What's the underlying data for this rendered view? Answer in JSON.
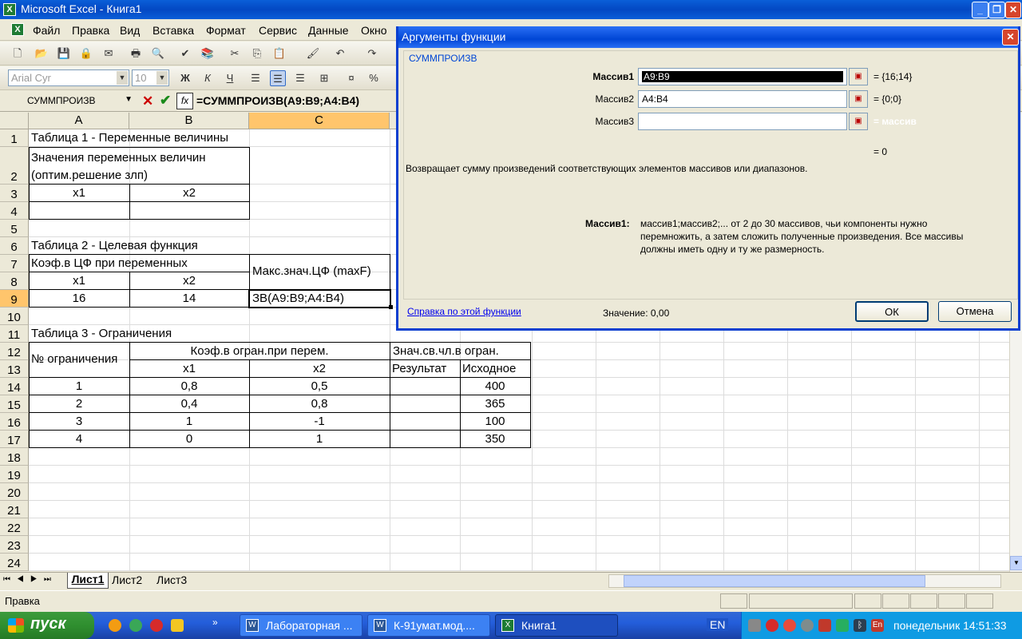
{
  "window": {
    "title": "Microsoft Excel - Книга1"
  },
  "menu": [
    "Файл",
    "Правка",
    "Вид",
    "Вставка",
    "Формат",
    "Сервис",
    "Данные",
    "Окно"
  ],
  "font": {
    "name": "Arial Cyr",
    "size": "10"
  },
  "namebox": "СУММПРОИЗВ",
  "formula": "=СУММПРОИЗВ(A9:B9;A4:B4)",
  "columns": [
    "A",
    "B",
    "C"
  ],
  "rows": [
    "1",
    "2",
    "3",
    "4",
    "5",
    "6",
    "7",
    "8",
    "9",
    "10",
    "11",
    "12",
    "13",
    "14",
    "15",
    "16",
    "17",
    "18",
    "19",
    "20",
    "21",
    "22",
    "23",
    "24"
  ],
  "cells": {
    "a1": "Таблица 1 - Переменные величины",
    "a2_1": "Значения переменных величин",
    "a2_2": "(оптим.решение злп)",
    "a3": "x1",
    "b3": "x2",
    "a6": "Таблица 2 - Целевая функция",
    "a7": "Коэф.в ЦФ при переменных",
    "c7": "Макс.знач.ЦФ (maxF)",
    "a8": "x1",
    "b8": "x2",
    "a9": "16",
    "b9": "14",
    "c9": "ЗВ(A9:B9;A4:B4)",
    "a11": "Таблица 3 - Ограничения",
    "a12": "№ ограничения",
    "b12": "Коэф.в огран.при перем.",
    "d12": "Знач.св.чл.в огран.",
    "b13": "x1",
    "c13": "x2",
    "d13": "Результат",
    "e13": "Исходное"
  },
  "table3": [
    {
      "n": "1",
      "x1": "0,8",
      "x2": "0,5",
      "src": "400"
    },
    {
      "n": "2",
      "x1": "0,4",
      "x2": "0,8",
      "src": "365"
    },
    {
      "n": "3",
      "x1": "1",
      "x2": "-1",
      "src": "100"
    },
    {
      "n": "4",
      "x1": "0",
      "x2": "1",
      "src": "350"
    }
  ],
  "sheets": [
    "Лист1",
    "Лист2",
    "Лист3"
  ],
  "status": "Правка",
  "dialog": {
    "title": "Аргументы функции",
    "func": "СУММПРОИЗВ",
    "args": [
      {
        "label": "Массив1",
        "value": "A9:B9",
        "result": "= {16;14}"
      },
      {
        "label": "Массив2",
        "value": "A4:B4",
        "result": "= {0;0}"
      },
      {
        "label": "Массив3",
        "value": "",
        "result": "= массив"
      }
    ],
    "total": "= 0",
    "description": "Возвращает сумму произведений соответствующих элементов массивов или диапазонов.",
    "arg_help_label": "Массив1:",
    "arg_help_1": "массив1;массив2;... от 2 до 30 массивов, чьи компоненты нужно",
    "arg_help_2": "перемножить, а затем сложить полученные произведения. Все массивы",
    "arg_help_3": "должны иметь одну и ту же размерность.",
    "help_link": "Справка по этой функции",
    "value_text": "Значение: 0,00",
    "ok": "ОК",
    "cancel": "Отмена"
  },
  "taskbar": {
    "start": "пуск",
    "tasks": [
      "Лабораторная ...",
      "К-91умат.мод....",
      "Книга1"
    ],
    "lang": "EN",
    "clock": "понедельник 14:51:33"
  }
}
